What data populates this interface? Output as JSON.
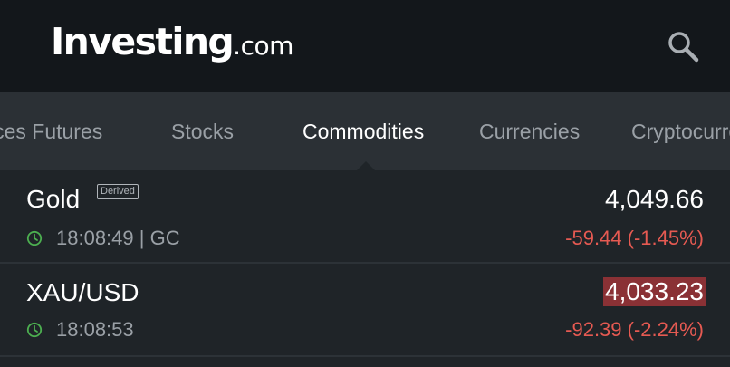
{
  "app": {
    "logo_main": "Investing",
    "logo_suffix": ".com",
    "search_icon": "search-icon"
  },
  "tabs": [
    {
      "label": "Indices Futures"
    },
    {
      "label": "Stocks"
    },
    {
      "label": "Commodities",
      "active": true
    },
    {
      "label": "Currencies"
    },
    {
      "label": "Cryptocurrency"
    }
  ],
  "quotes": [
    {
      "name": "Gold",
      "badge": "Derived",
      "time": "18:08:49 | GC",
      "price": "4,049.66",
      "change": "-59.44 (-1.45%)",
      "status_icon": "clock-icon"
    },
    {
      "name": "XAU/USD",
      "time": "18:08:53",
      "price": "4,033.23",
      "change": "-92.39 (-2.24%)",
      "status_icon": "clock-icon"
    }
  ],
  "colors": {
    "header_bg": "#13171b",
    "tabs_bg": "#2b3035",
    "list_bg": "#1f2428",
    "negative": "#e65a52",
    "clock_green": "#4caf50",
    "price_flash_bg": "#8a3135"
  }
}
